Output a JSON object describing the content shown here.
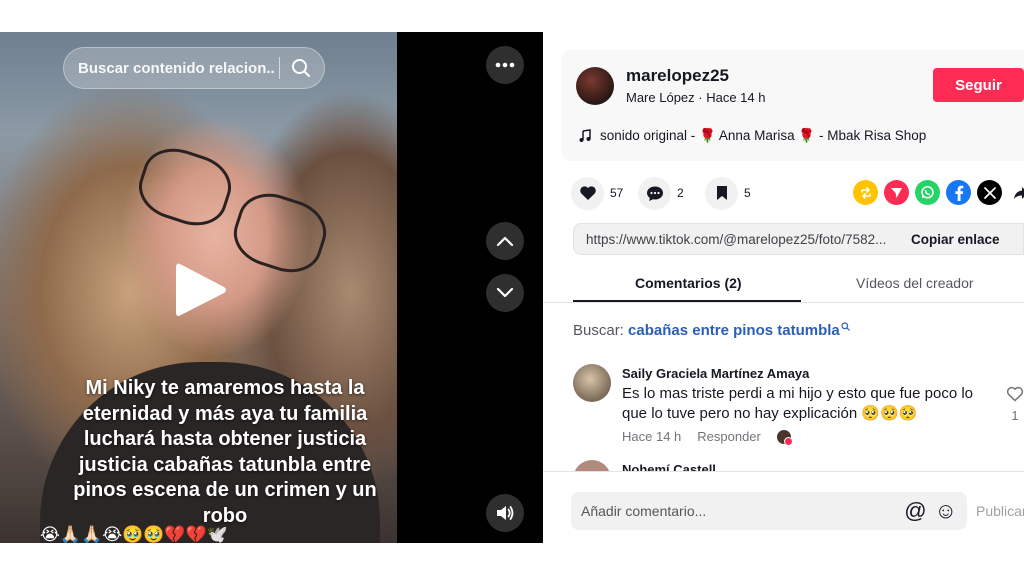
{
  "media": {
    "search_placeholder": "Buscar contenido relacion...",
    "caption": "Mi Niky te amaremos hasta la eternidad y más aya tu familia luchará hasta obtener justicia justicia cabañas tatunbla entre pinos escena de un crimen y un robo",
    "emoji_row": "😭🙏🏻🙏🏻😭🥹🥹💔💔🕊️"
  },
  "author": {
    "username": "marelopez25",
    "meta": "Mare López · Hace 14 h",
    "follow_label": "Seguir",
    "music": "sonido original - 🌹 Anna Marisa 🌹 - Mbak Risa Shop"
  },
  "actions": {
    "likes": "57",
    "comments": "2",
    "saves": "5"
  },
  "link": {
    "url": "https://www.tiktok.com/@marelopez25/foto/7582...",
    "copy_label": "Copiar enlace"
  },
  "tabs": {
    "comments": "Comentarios (2)",
    "creator_videos": "Vídeos del creador"
  },
  "search_suggest": {
    "label": "Buscar:",
    "query": "cabañas entre pinos tatumbla"
  },
  "comments": [
    {
      "name": "Saily Graciela Martínez Amaya",
      "text": "Es lo mas triste perdi a mi hijo y esto que fue poco lo que lo tuve pero no hay explicación 🥺🥺🥺",
      "time": "Hace 14 h",
      "reply": "Responder",
      "likes": "1"
    },
    {
      "name": "Nohemí Castell..."
    }
  ],
  "bottom": {
    "input_placeholder": "Añadir comentario...",
    "at_symbol": "@",
    "emoji_symbol": "☺",
    "publish_label": "Publicar"
  },
  "colors": {
    "accent": "#fe2c55",
    "link_blue": "#2b5db9"
  },
  "icons": [
    "search-icon",
    "more-icon",
    "play-icon",
    "chevron-up-icon",
    "chevron-down-icon",
    "volume-icon",
    "music-note-icon",
    "heart-icon",
    "comment-icon",
    "bookmark-icon",
    "repost-icon",
    "send-icon",
    "whatsapp-icon",
    "facebook-icon",
    "x-icon",
    "share-arrow-icon"
  ]
}
